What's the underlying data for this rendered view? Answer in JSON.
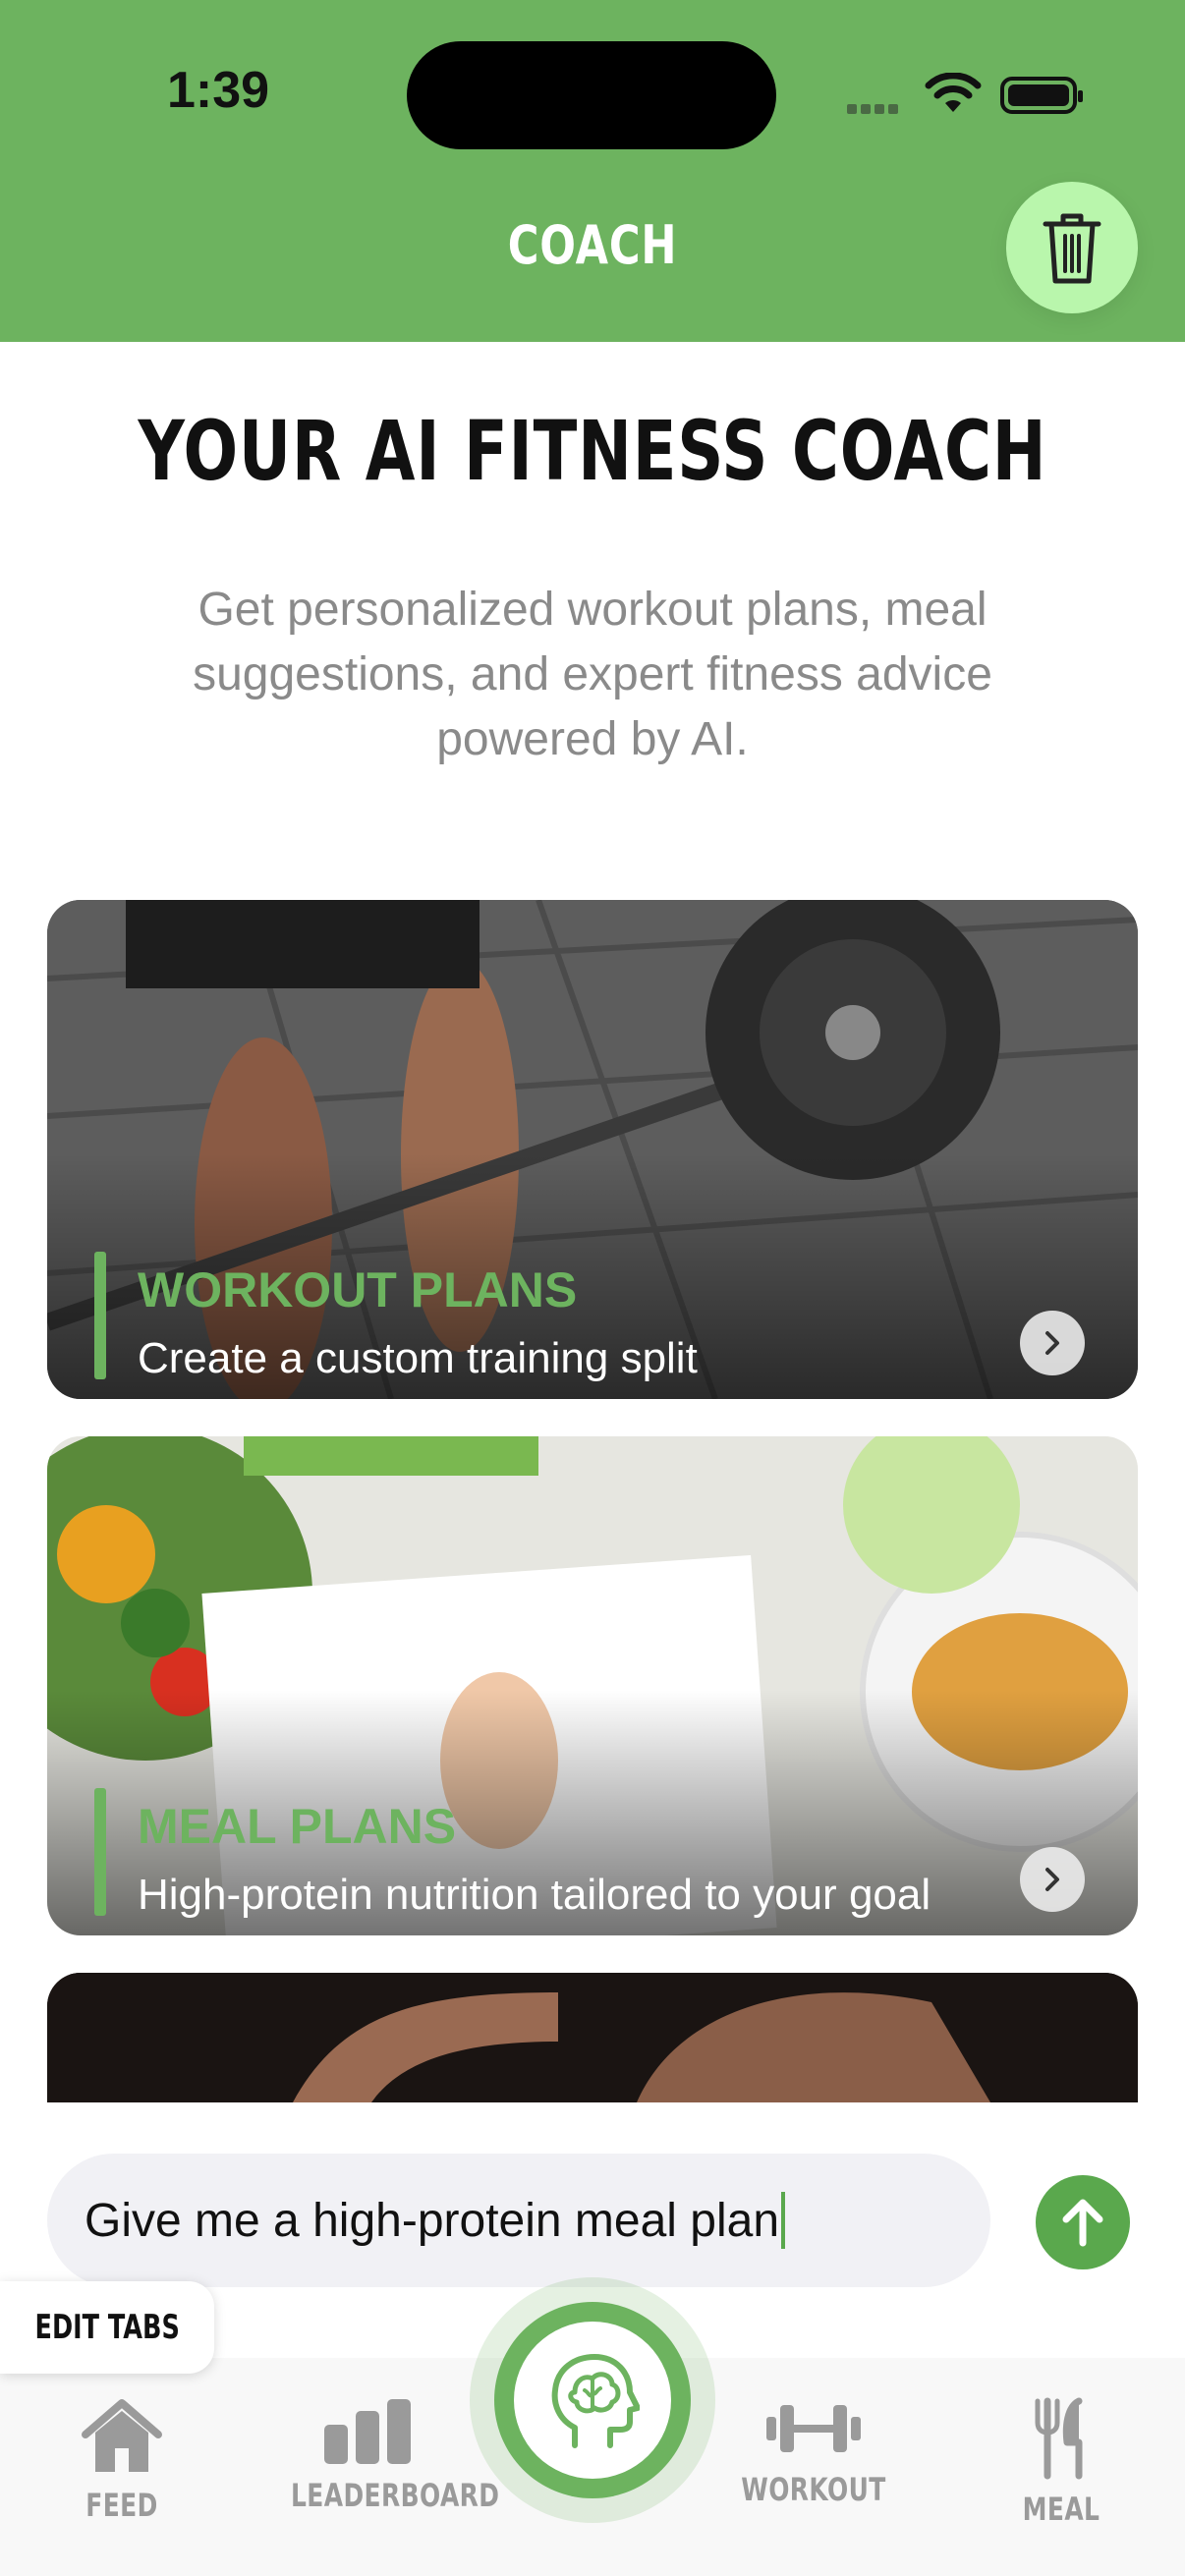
{
  "status": {
    "time": "1:39"
  },
  "nav": {
    "title": "COACH"
  },
  "hero": {
    "title": "YOUR AI FITNESS COACH",
    "subtitle": "Get personalized workout plans, meal suggestions, and expert fitness advice powered by AI."
  },
  "cards": [
    {
      "title": "WORKOUT PLANS",
      "subtitle": "Create a custom training split"
    },
    {
      "title": "MEAL PLANS",
      "subtitle": "High-protein nutrition tailored to your goal"
    }
  ],
  "chat": {
    "input_value": "Give me a high-protein meal plan"
  },
  "edit_tabs": {
    "label": "EDIT TABS"
  },
  "tabs": [
    {
      "label": "FEED",
      "icon": "home-icon"
    },
    {
      "label": "LEADERBOARD",
      "icon": "bar-chart-icon"
    },
    {
      "label": "",
      "icon": "brain-head-icon"
    },
    {
      "label": "WORKOUT",
      "icon": "dumbbell-icon"
    },
    {
      "label": "MEAL",
      "icon": "fork-knife-icon"
    }
  ],
  "colors": {
    "brand_green": "#6db35f",
    "trash_bg": "#b9f6ac",
    "send_green": "#5aa84d"
  }
}
